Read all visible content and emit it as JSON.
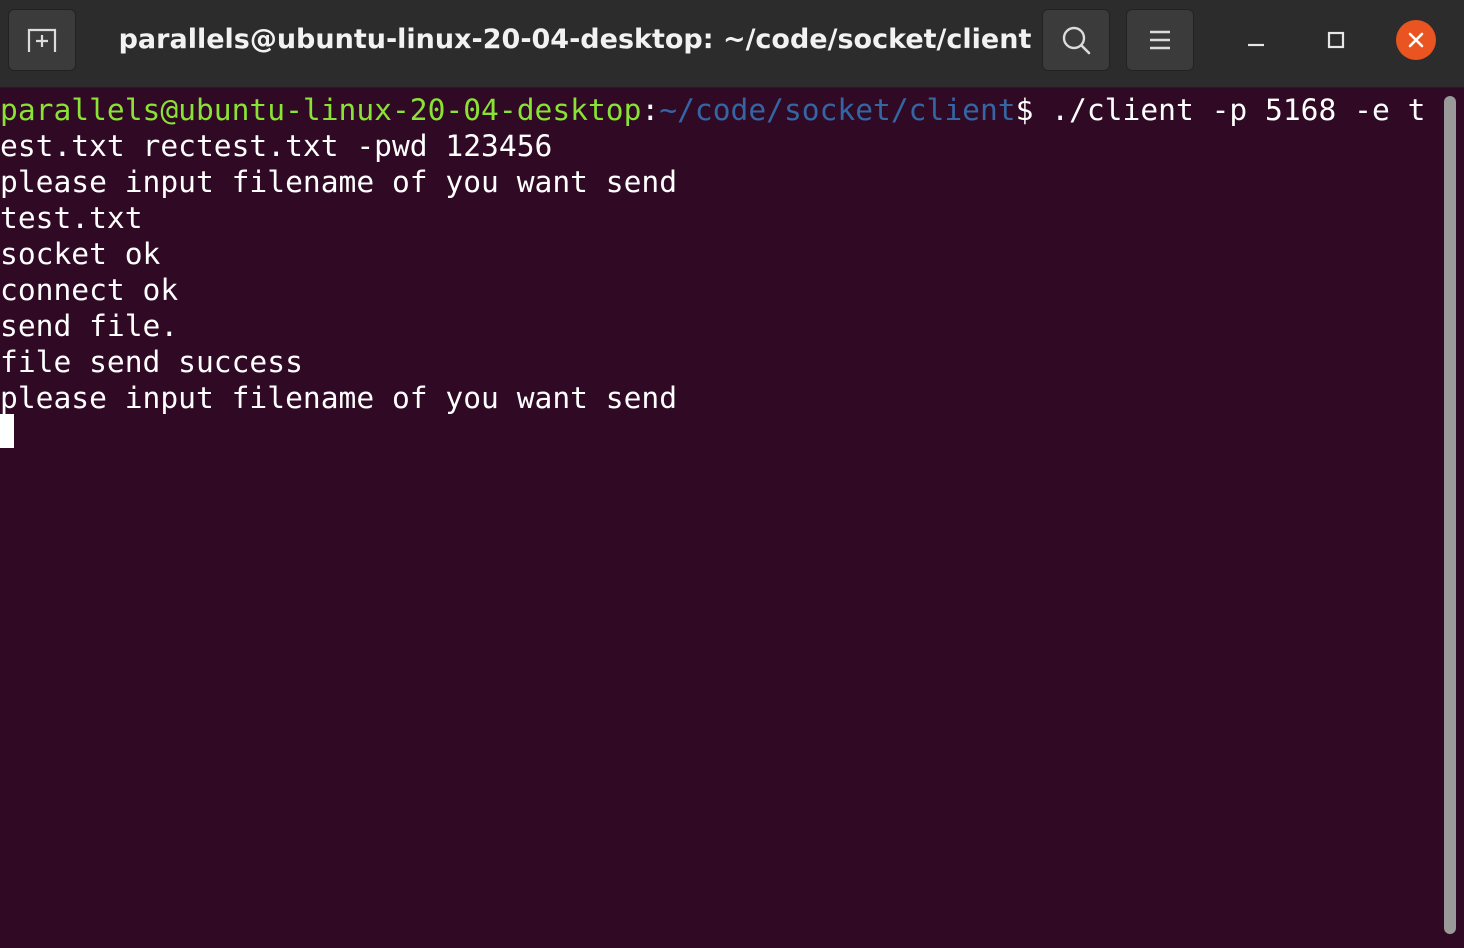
{
  "window": {
    "title": "parallels@ubuntu-linux-20-04-desktop: ~/code/socket/client"
  },
  "header_icons": {
    "new_tab": "new-tab-icon",
    "search": "search-icon",
    "menu": "hamburger-menu-icon",
    "minimize": "minimize-icon",
    "maximize": "maximize-icon",
    "close": "close-icon"
  },
  "terminal": {
    "prompt": {
      "user_host": "parallels@ubuntu-linux-20-04-desktop",
      "separator": ":",
      "path": "~/code/socket/client",
      "symbol": "$ ",
      "command": "./client -p 5168 -e t"
    },
    "lines": [
      "est.txt rectest.txt -pwd 123456",
      "please input filename of you want send",
      "test.txt",
      "socket ok",
      "connect ok",
      "send file.",
      "file send success",
      "please input filename of you want send"
    ]
  },
  "colors": {
    "terminal_bg": "#300a24",
    "header_bg": "#2c2c2c",
    "prompt_user": "#8ae234",
    "prompt_path": "#3465a4",
    "close_button": "#e95420"
  }
}
